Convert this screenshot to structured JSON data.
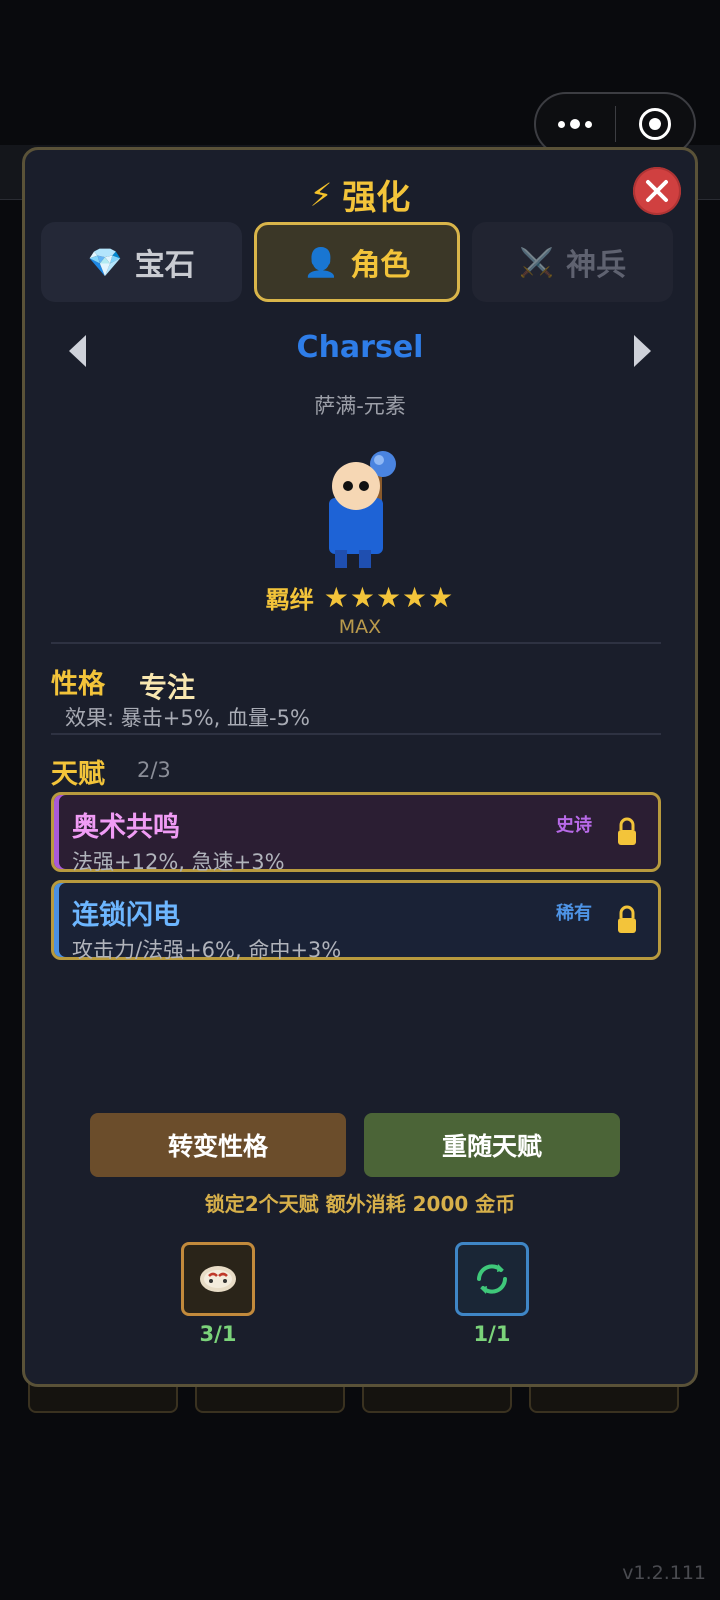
{
  "window": {
    "version": "v1.2.111"
  },
  "modal": {
    "title": "强化",
    "title_icon": "lightning-icon",
    "tabs": [
      {
        "label": "宝石",
        "icon": "diamond-icon",
        "state": "normal"
      },
      {
        "label": "角色",
        "icon": "person-icon",
        "state": "active"
      },
      {
        "label": "神兵",
        "icon": "crossed-swords-icon",
        "state": "disabled"
      }
    ],
    "hero": {
      "name": "Charsel",
      "class": "萨满-元素",
      "bond_label": "羁绊",
      "stars": "★★★★★",
      "star_count": 5,
      "bond_level": "MAX"
    },
    "personality": {
      "label": "性格",
      "value": "专注",
      "effect": "效果: 暴击+5%, 血量-5%"
    },
    "talents": {
      "label": "天赋",
      "count": "2/3",
      "items": [
        {
          "name": "奥术共鸣",
          "desc": "法强+12%, 急速+3%",
          "rarity": "史诗",
          "rarity_color": "#b86ae8",
          "locked": true
        },
        {
          "name": "连锁闪电",
          "desc": "攻击力/法强+6%, 命中+3%",
          "rarity": "稀有",
          "rarity_color": "#4e94e6",
          "locked": true
        }
      ]
    },
    "actions": {
      "change_personality": "转变性格",
      "reroll_talent": "重随天赋",
      "cost_note": "锁定2个天赋 额外消耗 2000 金币"
    },
    "items": [
      {
        "icon": "personality-scroll-icon",
        "count": "3/1"
      },
      {
        "icon": "refresh-icon",
        "count": "1/1"
      }
    ],
    "colors": {
      "accent_gold": "#f3c43a",
      "epic": "#b86ae8",
      "rare": "#4e94e6",
      "close": "#d04040"
    }
  }
}
